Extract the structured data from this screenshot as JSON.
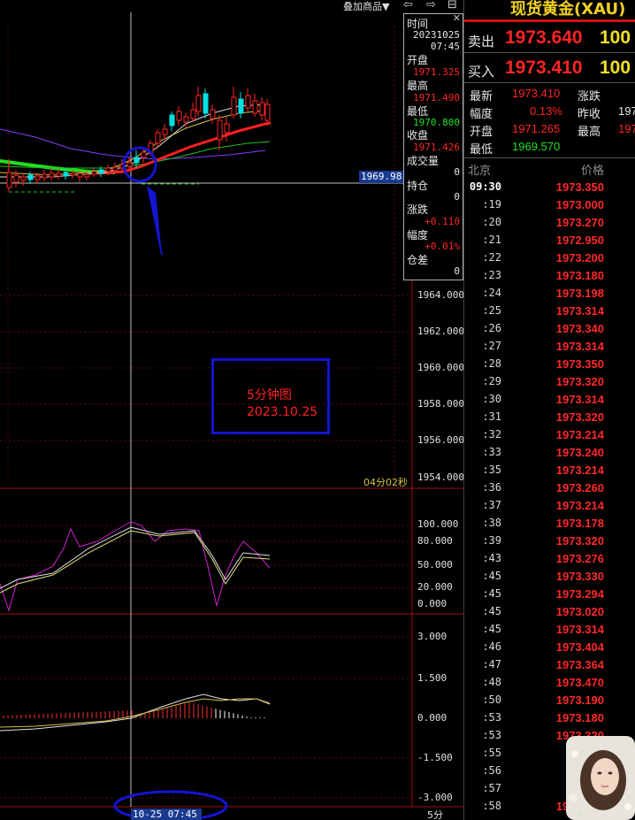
{
  "toolbar": {
    "overlay_label": "叠加商品▼",
    "back_icon": "arrow-left-icon",
    "forward_icon": "arrow-right-icon",
    "window_icon": "window-icon"
  },
  "info_box": {
    "time_label": "时间",
    "date": "20231025",
    "time": "07:45",
    "open_label": "开盘",
    "open": "1971.325",
    "high_label": "最高",
    "high": "1971.490",
    "low_label": "最低",
    "low": "1970.800",
    "close_label": "收盘",
    "close": "1971.426",
    "volume_label": "成交量",
    "volume": "0",
    "position_label": "持仓",
    "position": "0",
    "change_label": "涨跌",
    "change": "+0.110",
    "pct_label": "幅度",
    "pct": "+0.01%",
    "oi_diff_label": "仓差",
    "oi_diff": "0",
    "close_icon": "close-icon"
  },
  "main_chart": {
    "current_price_tag": "1969.98",
    "y_labels": [
      "1964.000",
      "1962.000",
      "1960.000",
      "1958.000",
      "1956.000",
      "1954.000"
    ],
    "countdown": "04分02秒",
    "annotation_line1": "5分钟图",
    "annotation_line2": "2023.10.25"
  },
  "oscillator": {
    "y_labels": [
      "100.000",
      "80.000",
      "50.000",
      "20.000",
      "0.000"
    ]
  },
  "macd": {
    "y_labels": [
      "3.000",
      "1.500",
      "0.000",
      "-1.500",
      "-3.000"
    ]
  },
  "footer": {
    "time_tag": "10-25 07:45",
    "period": "5分"
  },
  "colors": {
    "up": "#ff2424",
    "down": "#00e0e0",
    "accent_blue": "#1414d2",
    "title_yellow": "#f0d020",
    "volume_yellow": "#f0e020",
    "low_green": "#20e020"
  },
  "quote_panel": {
    "title": "现货黄金(XAU)",
    "sell_label": "卖出",
    "sell_price": "1973.640",
    "sell_volume": "100",
    "buy_label": "买入",
    "buy_price": "1973.410",
    "buy_volume": "100",
    "stats": {
      "last_label": "最新",
      "last": "1973.410",
      "change_label": "涨跌",
      "change": "",
      "pct_label": "幅度",
      "pct": "0.13%",
      "prev_close_label": "昨收",
      "prev_close": "197",
      "open_label": "开盘",
      "open": "1971.265",
      "high_label": "最高",
      "high": "197",
      "low_label": "最低",
      "low": "1969.570"
    },
    "tick_header_left": "北京",
    "tick_header_right": "价格",
    "ticks": [
      {
        "time": "09:30",
        "price": "1973.350"
      },
      {
        "time": ":19",
        "price": "1973.000"
      },
      {
        "time": ":20",
        "price": "1973.270"
      },
      {
        "time": ":21",
        "price": "1972.950"
      },
      {
        "time": ":22",
        "price": "1973.200"
      },
      {
        "time": ":23",
        "price": "1973.180"
      },
      {
        "time": ":24",
        "price": "1973.198"
      },
      {
        "time": ":25",
        "price": "1973.314"
      },
      {
        "time": ":26",
        "price": "1973.340"
      },
      {
        "time": ":27",
        "price": "1973.314"
      },
      {
        "time": ":28",
        "price": "1973.350"
      },
      {
        "time": ":29",
        "price": "1973.320"
      },
      {
        "time": ":30",
        "price": "1973.314"
      },
      {
        "time": ":31",
        "price": "1973.320"
      },
      {
        "time": ":32",
        "price": "1973.214"
      },
      {
        "time": ":33",
        "price": "1973.240"
      },
      {
        "time": ":35",
        "price": "1973.214"
      },
      {
        "time": ":36",
        "price": "1973.260"
      },
      {
        "time": ":37",
        "price": "1973.214"
      },
      {
        "time": ":38",
        "price": "1973.178"
      },
      {
        "time": ":39",
        "price": "1973.320"
      },
      {
        "time": ":43",
        "price": "1973.276"
      },
      {
        "time": ":45",
        "price": "1973.330"
      },
      {
        "time": ":45",
        "price": "1973.294"
      },
      {
        "time": ":45",
        "price": "1973.020"
      },
      {
        "time": ":45",
        "price": "1973.314"
      },
      {
        "time": ":46",
        "price": "1973.404"
      },
      {
        "time": ":47",
        "price": "1973.364"
      },
      {
        "time": ":48",
        "price": "1973.470"
      },
      {
        "time": ":50",
        "price": "1973.190"
      },
      {
        "time": ":53",
        "price": "1973.180"
      },
      {
        "time": ":53",
        "price": "1973.320"
      },
      {
        "time": ":55",
        "price": "19"
      },
      {
        "time": ":56",
        "price": "19"
      },
      {
        "time": ":57",
        "price": "19"
      },
      {
        "time": ":58",
        "price": "1973.410"
      }
    ],
    "avatar_icon": "user-avatar"
  }
}
